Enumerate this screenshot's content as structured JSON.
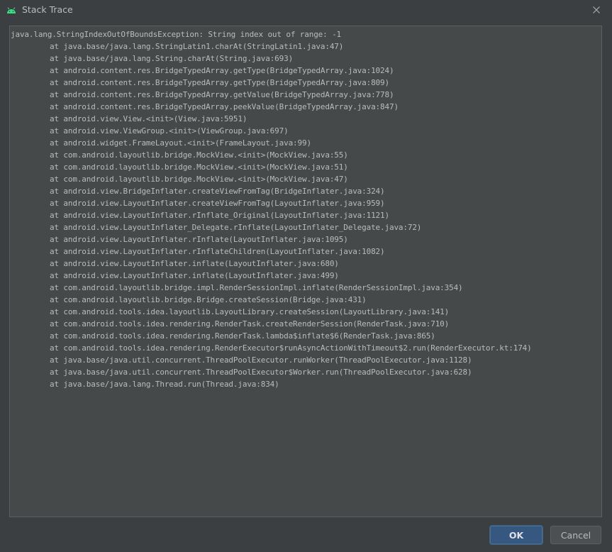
{
  "window": {
    "title": "Stack Trace",
    "app_icon": "android-icon",
    "close_icon": "close-icon"
  },
  "trace": {
    "exception": "java.lang.StringIndexOutOfBoundsException: String index out of range: -1",
    "frames": [
      "at java.base/java.lang.StringLatin1.charAt(StringLatin1.java:47)",
      "at java.base/java.lang.String.charAt(String.java:693)",
      "at android.content.res.BridgeTypedArray.getType(BridgeTypedArray.java:1024)",
      "at android.content.res.BridgeTypedArray.getType(BridgeTypedArray.java:809)",
      "at android.content.res.BridgeTypedArray.getValue(BridgeTypedArray.java:778)",
      "at android.content.res.BridgeTypedArray.peekValue(BridgeTypedArray.java:847)",
      "at android.view.View.<init>(View.java:5951)",
      "at android.view.ViewGroup.<init>(ViewGroup.java:697)",
      "at android.widget.FrameLayout.<init>(FrameLayout.java:99)",
      "at com.android.layoutlib.bridge.MockView.<init>(MockView.java:55)",
      "at com.android.layoutlib.bridge.MockView.<init>(MockView.java:51)",
      "at com.android.layoutlib.bridge.MockView.<init>(MockView.java:47)",
      "at android.view.BridgeInflater.createViewFromTag(BridgeInflater.java:324)",
      "at android.view.LayoutInflater.createViewFromTag(LayoutInflater.java:959)",
      "at android.view.LayoutInflater.rInflate_Original(LayoutInflater.java:1121)",
      "at android.view.LayoutInflater_Delegate.rInflate(LayoutInflater_Delegate.java:72)",
      "at android.view.LayoutInflater.rInflate(LayoutInflater.java:1095)",
      "at android.view.LayoutInflater.rInflateChildren(LayoutInflater.java:1082)",
      "at android.view.LayoutInflater.inflate(LayoutInflater.java:680)",
      "at android.view.LayoutInflater.inflate(LayoutInflater.java:499)",
      "at com.android.layoutlib.bridge.impl.RenderSessionImpl.inflate(RenderSessionImpl.java:354)",
      "at com.android.layoutlib.bridge.Bridge.createSession(Bridge.java:431)",
      "at com.android.tools.idea.layoutlib.LayoutLibrary.createSession(LayoutLibrary.java:141)",
      "at com.android.tools.idea.rendering.RenderTask.createRenderSession(RenderTask.java:710)",
      "at com.android.tools.idea.rendering.RenderTask.lambda$inflate$6(RenderTask.java:865)",
      "at com.android.tools.idea.rendering.RenderExecutor$runAsyncActionWithTimeout$2.run(RenderExecutor.kt:174)",
      "at java.base/java.util.concurrent.ThreadPoolExecutor.runWorker(ThreadPoolExecutor.java:1128)",
      "at java.base/java.util.concurrent.ThreadPoolExecutor$Worker.run(ThreadPoolExecutor.java:628)",
      "at java.base/java.lang.Thread.run(Thread.java:834)"
    ]
  },
  "buttons": {
    "ok_label": "OK",
    "cancel_label": "Cancel"
  },
  "colors": {
    "background": "#3c3f41",
    "text_area": "#45494a",
    "text": "#bbbbbb",
    "primary_button": "#365880",
    "android_green": "#3ddc84"
  }
}
